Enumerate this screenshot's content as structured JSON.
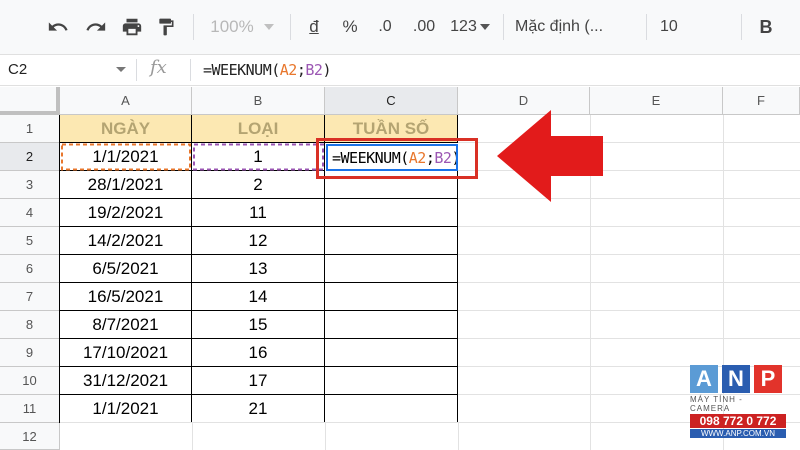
{
  "toolbar": {
    "zoom": "100%",
    "currency": "đ",
    "percent": "%",
    "dec_decrease": ".0",
    "dec_increase": ".00",
    "more_formats": "123",
    "font": "Mặc định (...",
    "font_size": "10",
    "bold": "B"
  },
  "formula_bar": {
    "name_box": "C2",
    "fx": "fx",
    "formula_prefix": "=WEEKNUM(",
    "ref_a": "A2",
    "semi": ";",
    "ref_b": "B2",
    "formula_suffix": ")"
  },
  "columns": [
    "A",
    "B",
    "C",
    "D",
    "E",
    "F"
  ],
  "rows": [
    "1",
    "2",
    "3",
    "4",
    "5",
    "6",
    "7",
    "8",
    "9",
    "10",
    "11",
    "12"
  ],
  "headers": {
    "a": "NGÀY",
    "b": "LOẠI",
    "c": "TUẦN SỐ"
  },
  "data": [
    {
      "date": "1/1/2021",
      "type": "1"
    },
    {
      "date": "28/1/2021",
      "type": "2"
    },
    {
      "date": "19/2/2021",
      "type": "11"
    },
    {
      "date": "14/2/2021",
      "type": "12"
    },
    {
      "date": "6/5/2021",
      "type": "13"
    },
    {
      "date": "16/5/2021",
      "type": "14"
    },
    {
      "date": "8/7/2021",
      "type": "15"
    },
    {
      "date": "17/10/2021",
      "type": "16"
    },
    {
      "date": "31/12/2021",
      "type": "17"
    },
    {
      "date": "1/1/2021",
      "type": "21"
    }
  ],
  "colors": {
    "arrow": "#e21b1b",
    "highlight": "#d93025",
    "active": "#1a73e8",
    "header_fill": "#fce8b2"
  },
  "logo": {
    "letters": [
      "A",
      "N",
      "P"
    ],
    "tagline": "MÁY TÍNH - CAMERA",
    "phone": "098 772 0 772",
    "website": "WWW.ANP.COM.VN"
  }
}
